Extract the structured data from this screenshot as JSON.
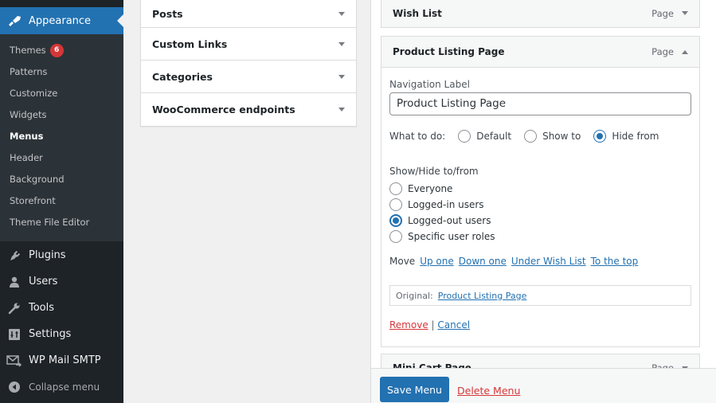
{
  "sidebar": {
    "active_menu": {
      "label": "Appearance",
      "icon": "paintbrush-icon"
    },
    "submenu": [
      {
        "label": "Themes",
        "badge": "6"
      },
      {
        "label": "Patterns"
      },
      {
        "label": "Customize"
      },
      {
        "label": "Widgets"
      },
      {
        "label": "Menus",
        "current": true
      },
      {
        "label": "Header"
      },
      {
        "label": "Background"
      },
      {
        "label": "Storefront"
      },
      {
        "label": "Theme File Editor"
      }
    ],
    "menu": [
      {
        "label": "Plugins",
        "icon": "plugin-icon"
      },
      {
        "label": "Users",
        "icon": "user-icon"
      },
      {
        "label": "Tools",
        "icon": "wrench-icon"
      },
      {
        "label": "Settings",
        "icon": "settings-icon"
      },
      {
        "label": "WP Mail SMTP",
        "icon": "mail-icon"
      }
    ],
    "collapse_label": "Collapse menu"
  },
  "accordion": {
    "items": [
      {
        "label": "Posts"
      },
      {
        "label": "Custom Links"
      },
      {
        "label": "Categories"
      },
      {
        "label": "WooCommerce endpoints"
      }
    ]
  },
  "structure": {
    "wish_list": {
      "title": "Wish List",
      "type": "Page"
    },
    "product_listing": {
      "title": "Product Listing Page",
      "type": "Page",
      "nav_label_caption": "Navigation Label",
      "nav_label_value": "Product Listing Page",
      "what_to_do_label": "What to do:",
      "what_to_do_options": [
        "Default",
        "Show to",
        "Hide from"
      ],
      "what_to_do_selected": "Hide from",
      "show_hide_label": "Show/Hide to/from",
      "show_hide_options": [
        "Everyone",
        "Logged-in users",
        "Logged-out users",
        "Specific user roles"
      ],
      "show_hide_selected": "Logged-out users",
      "move_label": "Move",
      "move_links": [
        "Up one",
        "Down one",
        "Under Wish List",
        "To the top"
      ],
      "original_label": "Original:",
      "original_link": "Product Listing Page",
      "remove_label": "Remove",
      "separator": "|",
      "cancel_label": "Cancel"
    },
    "mini_cart": {
      "title": "Mini Cart Page",
      "type": "Page"
    }
  },
  "footer": {
    "save_label": "Save Menu",
    "delete_label": "Delete Menu"
  },
  "colors": {
    "accent": "#2271b1",
    "danger": "#d63638",
    "sidebar_bg": "#1d2327",
    "submenu_bg": "#2c3338"
  }
}
